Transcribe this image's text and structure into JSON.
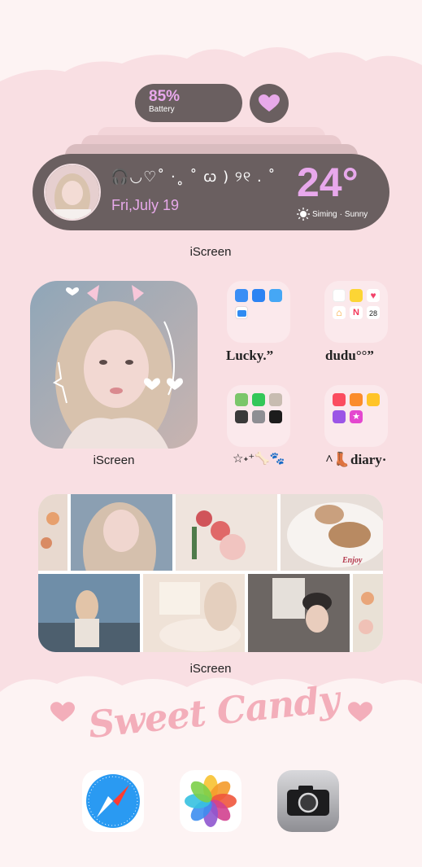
{
  "battery": {
    "percent": "85%",
    "label": "Battery"
  },
  "main_widget": {
    "decoration": "🎧◡♡˚ ·˳ ˚ ꞷ ) ୨୧ . ˚",
    "date": "Fri,July 19",
    "temperature": "24°",
    "location": "Siming",
    "separator": "·",
    "condition": "Sunny"
  },
  "labels": {
    "widget_top": "iScreen",
    "widget_photo": "iScreen",
    "widget_gallery": "iScreen"
  },
  "folders": [
    {
      "label": "Lucky.”",
      "icon": "cloud-character-icon"
    },
    {
      "label": "dudu°°”",
      "icon": "speech-bubble-icon"
    },
    {
      "label": "☆˖⁺🦴🐾",
      "icon": "bone-paw-icon"
    },
    {
      "label": "^👢diary·",
      "icon": "boot-icon"
    }
  ],
  "folder_apps": [
    [
      "app-store-icon",
      "mail-icon",
      "cloud-drive-icon",
      "files-icon"
    ],
    [
      "reminders-icon",
      "notes-icon",
      "health-icon",
      "home-icon",
      "news-icon",
      "calendar-icon"
    ],
    [
      "maps-icon",
      "find-my-icon",
      "contacts-icon",
      "calculator-icon",
      "settings-icon",
      "clock-icon"
    ],
    [
      "music-icon",
      "books-icon",
      "tips-icon",
      "podcasts-icon",
      "itunes-store-icon"
    ]
  ],
  "calendar": {
    "day": "28"
  },
  "banner": {
    "text": "Sweet Candy"
  },
  "gallery": {
    "caption": "Enjoy"
  },
  "dock": [
    "safari-icon",
    "photos-icon",
    "camera-icon"
  ],
  "colors": {
    "background": "#f9dfe3",
    "widget": "#6a5f60",
    "accent": "#e8a8ec",
    "banner": "#f3aeba"
  }
}
